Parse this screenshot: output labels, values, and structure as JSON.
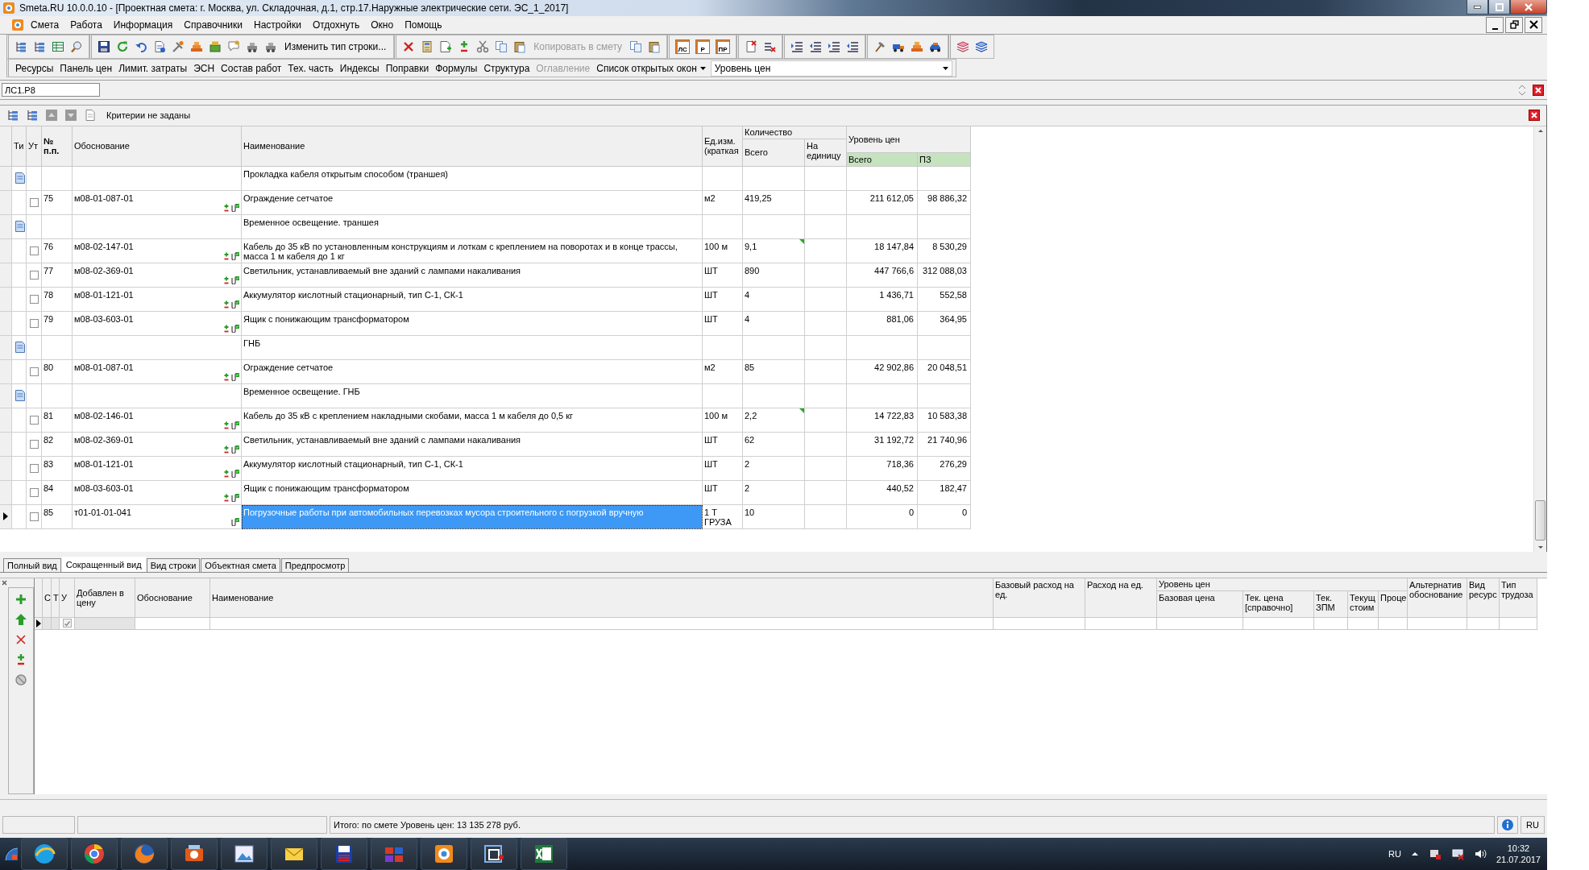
{
  "window": {
    "title": "Smeta.RU  10.0.0.10  - [Проектная смета: г. Москва, ул. Складочная, д.1, стр.17.Наружные электрические сети. ЭС_1_2017]"
  },
  "menu": [
    "Смета",
    "Работа",
    "Информация",
    "Справочники",
    "Настройки",
    "Отдохнуть",
    "Окно",
    "Помощь"
  ],
  "toolbar": {
    "change_row_type": "Изменить тип строки...",
    "copy_to_estimate": {
      "label": "Копировать в смету",
      "disabled": true
    },
    "report_buttons": [
      "ЛС",
      "Р",
      "ПР"
    ]
  },
  "panels_bar": {
    "items": [
      {
        "label": "Ресурсы",
        "disabled": false
      },
      {
        "label": "Панель цен",
        "disabled": false
      },
      {
        "label": "Лимит. затраты",
        "disabled": false
      },
      {
        "label": "ЭСН",
        "disabled": false
      },
      {
        "label": "Состав работ",
        "disabled": false
      },
      {
        "label": "Тех. часть",
        "disabled": false
      },
      {
        "label": "Индексы",
        "disabled": false
      },
      {
        "label": "Поправки",
        "disabled": false
      },
      {
        "label": "Формулы",
        "disabled": false
      },
      {
        "label": "Структура",
        "disabled": false
      },
      {
        "label": "Оглавление",
        "disabled": true
      }
    ],
    "open_windows": "Список открытых окон",
    "price_level": "Уровень цен"
  },
  "address": {
    "value": "ЛС1.Р8"
  },
  "filter": {
    "text": "Критерии не заданы"
  },
  "main_table": {
    "columns": {
      "type": "Ти",
      "ut": "Ут",
      "number": "№ п.п.",
      "basis": "Обоснование",
      "name": "Наименование",
      "unit": "Ед.изм. (краткая",
      "quantity": "Количество",
      "qty_total": "Всего",
      "qty_per_unit": "На единицу",
      "price_level": "Уровень цен",
      "price_total": "Всего",
      "pz": "ПЗ"
    },
    "rows": [
      {
        "kind": "section",
        "name": "Прокладка кабеля открытым способом (траншея)",
        "selected": false
      },
      {
        "kind": "item",
        "checked": false,
        "number": "75",
        "basis": "м08-01-087-01",
        "name": "Ограждение сетчатое",
        "unit": "м2",
        "qty_total": "419,25",
        "price_total": "211 612,05",
        "pz": "98 886,32",
        "flagged": false,
        "adjustable": true,
        "selected": false
      },
      {
        "kind": "section",
        "name": "Временное освещение. траншея",
        "selected": false
      },
      {
        "kind": "item",
        "checked": false,
        "number": "76",
        "basis": "м08-02-147-01",
        "name": "Кабель до 35 кВ по установленным конструкциям и лоткам с креплением на поворотах и в конце трассы, масса 1 м кабеля до 1 кг",
        "unit": "100 м",
        "qty_total": "9,1",
        "price_total": "18 147,84",
        "pz": "8 530,29",
        "flagged": true,
        "adjustable": true,
        "selected": false
      },
      {
        "kind": "item",
        "checked": false,
        "number": "77",
        "basis": "м08-02-369-01",
        "name": "Светильник, устанавливаемый вне зданий с лампами накаливания",
        "unit": "ШТ",
        "qty_total": "890",
        "price_total": "447 766,6",
        "pz": "312 088,03",
        "flagged": false,
        "adjustable": true,
        "selected": false
      },
      {
        "kind": "item",
        "checked": false,
        "number": "78",
        "basis": "м08-01-121-01",
        "name": "Аккумулятор кислотный стационарный, тип С-1, СК-1",
        "unit": "ШТ",
        "qty_total": "4",
        "price_total": "1 436,71",
        "pz": "552,58",
        "flagged": false,
        "adjustable": true,
        "selected": false
      },
      {
        "kind": "item",
        "checked": false,
        "number": "79",
        "basis": "м08-03-603-01",
        "name": "Ящик с понижающим трансформатором",
        "unit": "ШТ",
        "qty_total": "4",
        "price_total": "881,06",
        "pz": "364,95",
        "flagged": false,
        "adjustable": true,
        "selected": false
      },
      {
        "kind": "section",
        "name": "ГНБ",
        "selected": false
      },
      {
        "kind": "item",
        "checked": false,
        "number": "80",
        "basis": "м08-01-087-01",
        "name": "Ограждение сетчатое",
        "unit": "м2",
        "qty_total": "85",
        "price_total": "42 902,86",
        "pz": "20 048,51",
        "flagged": false,
        "adjustable": true,
        "selected": false
      },
      {
        "kind": "section",
        "name": "Временное освещение. ГНБ",
        "selected": false
      },
      {
        "kind": "item",
        "checked": false,
        "number": "81",
        "basis": "м08-02-146-01",
        "name": "Кабель до 35 кВ с креплением накладными скобами, масса 1 м кабеля до 0,5 кг",
        "unit": "100 м",
        "qty_total": "2,2",
        "price_total": "14 722,83",
        "pz": "10 583,38",
        "flagged": true,
        "adjustable": true,
        "selected": false
      },
      {
        "kind": "item",
        "checked": false,
        "number": "82",
        "basis": "м08-02-369-01",
        "name": "Светильник, устанавливаемый вне зданий с лампами накаливания",
        "unit": "ШТ",
        "qty_total": "62",
        "price_total": "31 192,72",
        "pz": "21 740,96",
        "flagged": false,
        "adjustable": true,
        "selected": false
      },
      {
        "kind": "item",
        "checked": false,
        "number": "83",
        "basis": "м08-01-121-01",
        "name": "Аккумулятор кислотный стационарный, тип С-1, СК-1",
        "unit": "ШТ",
        "qty_total": "2",
        "price_total": "718,36",
        "pz": "276,29",
        "flagged": false,
        "adjustable": true,
        "selected": false
      },
      {
        "kind": "item",
        "checked": false,
        "number": "84",
        "basis": "м08-03-603-01",
        "name": "Ящик с понижающим трансформатором",
        "unit": "ШТ",
        "qty_total": "2",
        "price_total": "440,52",
        "pz": "182,47",
        "flagged": false,
        "adjustable": true,
        "selected": false
      },
      {
        "kind": "item",
        "checked": false,
        "number": "85",
        "basis": "т01-01-01-041",
        "name": "Погрузочные работы при автомобильных перевозках мусора строительного с погрузкой вручную",
        "unit": "1 Т ГРУЗА",
        "qty_total": "10",
        "price_total": "0",
        "pz": "0",
        "flagged": false,
        "adjustable": false,
        "selected": true
      }
    ]
  },
  "view_tabs": [
    {
      "label": "Полный вид",
      "selected": false
    },
    {
      "label": "Сокращенный вид",
      "selected": true
    },
    {
      "label": "Вид строки",
      "selected": false
    },
    {
      "label": "Объектная смета",
      "selected": false
    },
    {
      "label": "Предпросмотр",
      "selected": false
    }
  ],
  "detail_table": {
    "group": "Уровень цен",
    "columns": [
      "С",
      "Т",
      "У",
      "Добавлен в цену",
      "Обоснование",
      "Наименование",
      "Базовый расход на ед.",
      "Расход на ед.",
      "Базовая цена",
      "Тек. цена [справочно]",
      "Тек. ЗПМ",
      "Текущ стоим",
      "Проце",
      "Альтернатив обоснование",
      "Вид ресурс",
      "Тип трудоза"
    ],
    "rows": [
      {
        "checked": true,
        "selected": true
      }
    ]
  },
  "status_bar": {
    "total": "Итого: по смете Уровень цен: 13 135 278 руб.",
    "language": "RU"
  },
  "taskbar": {
    "language": "RU",
    "time": "10:32",
    "date": "21.07.2017"
  }
}
